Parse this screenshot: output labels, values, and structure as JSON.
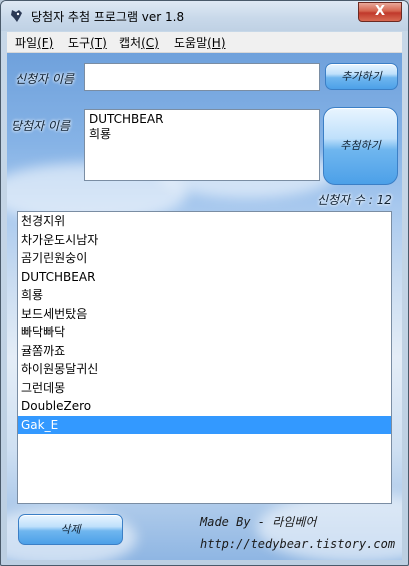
{
  "window": {
    "title": "당첨자 추첨 프로그램 ver 1.8",
    "close_glyph": "X"
  },
  "menu": [
    {
      "label": "파일",
      "accel": "(F)"
    },
    {
      "label": "도구",
      "accel": "(T)"
    },
    {
      "label": "캡처",
      "accel": "(C)"
    },
    {
      "label": "도움말",
      "accel": "(H)"
    }
  ],
  "form": {
    "applicant_label": "신청자 이름",
    "applicant_value": "",
    "add_button": "추가하기",
    "winner_label": "당첨자 이름",
    "winner_value": "DUTCHBEAR\n희룡",
    "draw_button": "추첨하기",
    "count_label": "신청자 수 : 12"
  },
  "applicants": [
    "천경지위",
    "차가운도시남자",
    "곰기린원숭이",
    "DUTCHBEAR",
    "희룡",
    "보드세번탔음",
    "빠닥빠닥",
    "귤쫌까죠",
    "하이원몽달귀신",
    "그런데몽",
    "DoubleZero",
    "Gak_E"
  ],
  "selected_index": 11,
  "footer": {
    "delete_button": "삭제",
    "made_by": "Made By - 라임베어",
    "url": "http://tedybear.tistory.com"
  },
  "colors": {
    "selection": "#3399ff",
    "button_blue": "#4ca0e8"
  }
}
